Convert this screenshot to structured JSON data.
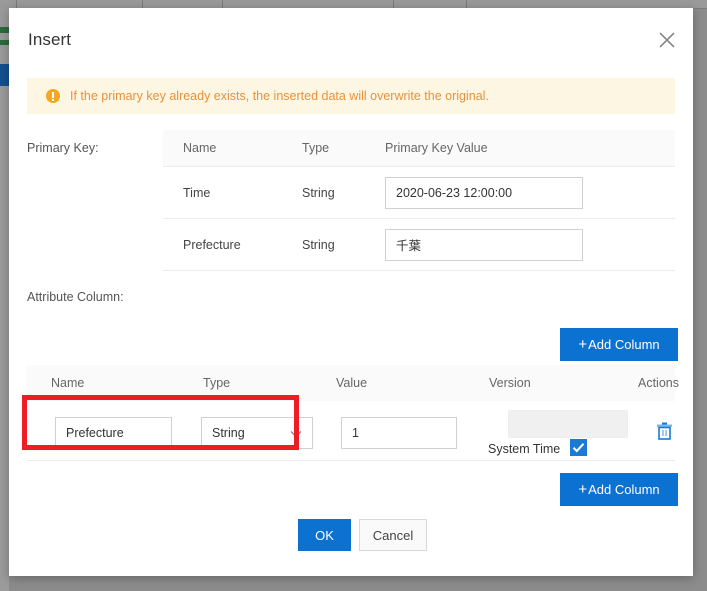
{
  "modal": {
    "title": "Insert",
    "close_icon": "close-icon",
    "warning": {
      "icon": "warning-circle-icon",
      "text": "If the primary key already exists, the inserted data will overwrite the original."
    },
    "primary_key": {
      "label": "Primary Key:",
      "columns": [
        "Name",
        "Type",
        "Primary Key Value"
      ],
      "rows": [
        {
          "name": "Time",
          "type": "String",
          "value": "2020-06-23 12:00:00"
        },
        {
          "name": "Prefecture",
          "type": "String",
          "value": "千葉"
        }
      ]
    },
    "attribute_column": {
      "label": "Attribute Column:",
      "add_column_label": "Add Column",
      "add_plus": "+",
      "columns": [
        "Name",
        "Type",
        "Value",
        "Version",
        "Actions"
      ],
      "row": {
        "name_value": "Prefecture",
        "type_value": "String",
        "type_chevron_icon": "chevron-down-icon",
        "value_value": "1",
        "version_value": "",
        "system_time_label": "System Time",
        "system_time_checked": true,
        "delete_icon": "trash-icon"
      }
    },
    "footer": {
      "ok_label": "OK",
      "cancel_label": "Cancel"
    }
  },
  "annotation": {
    "highlight_color": "#ee1c25"
  },
  "colors": {
    "primary_blue": "#0b72d1",
    "warning_bg": "#fdf6e3",
    "warning_text": "#e8913c",
    "checkbox_blue": "#1a7ad4"
  }
}
